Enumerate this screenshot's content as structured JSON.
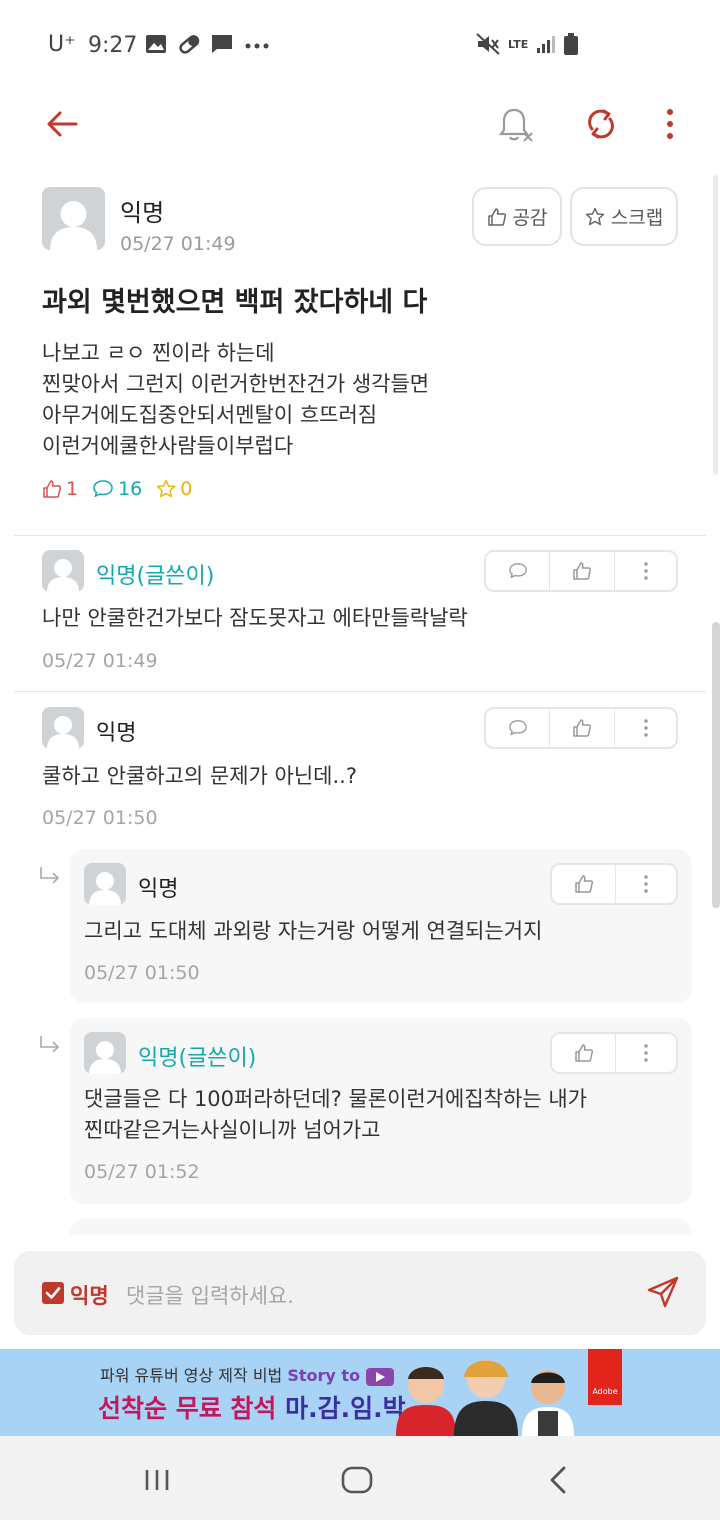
{
  "status_bar": {
    "carrier": "U⁺",
    "time": "9:27",
    "lte": "LTE"
  },
  "post": {
    "author": "익명",
    "timestamp": "05/27 01:49",
    "like_button": "공감",
    "scrap_button": "스크랩",
    "title": "과외 몇번했으면 백퍼 잤다하네 다",
    "body_lines": [
      "나보고 ㄹㅇ 찐이라 하는데",
      "찐맞아서 그런지 이런거한번잔건가 생각들면",
      "아무거에도집중안되서멘탈이 흐뜨러짐",
      "이런거에쿨한사람들이부럽다"
    ],
    "like_count": "1",
    "comment_count": "16",
    "scrap_count": "0"
  },
  "comments": [
    {
      "author": "익명(글쓴이)",
      "text": [
        "나만 안쿨한건가보다 잠도못자고 에타만들락날락"
      ],
      "time": "05/27 01:49"
    },
    {
      "author": "익명",
      "text": [
        "쿨하고 안쿨하고의 문제가 아닌데..?"
      ],
      "time": "05/27 01:50"
    }
  ],
  "replies": [
    {
      "author": "익명",
      "text": [
        "그리고 도대체 과외랑 자는거랑 어떻게 연결되는거지"
      ],
      "time": "05/27 01:50"
    },
    {
      "author": "익명(글쓴이)",
      "text": [
        "댓글들은 다 100퍼라하던데? 물론이런거에집착하는 내가",
        "찐따같은거는사실이니까 넘어가고"
      ],
      "time": "05/27 01:52"
    }
  ],
  "comment_input": {
    "anon_label": "익명",
    "placeholder": "댓글을 입력하세요."
  },
  "ad": {
    "line1_prefix": "파워 유튜버 영상 제작 비법",
    "line1_brand": "Story to",
    "line2_red": "선착순 무료 참석",
    "line2_blue": "마.감.임.박",
    "badge": "Adobe"
  },
  "colors": {
    "accent_red": "#c0392b",
    "op_teal": "#12a9ae",
    "count_red": "#d9534f",
    "count_teal": "#12a9ae",
    "count_yellow": "#e6b800"
  }
}
